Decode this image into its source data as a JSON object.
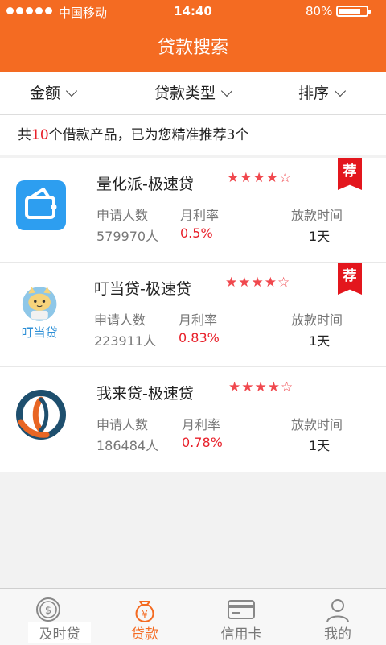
{
  "status_bar": {
    "carrier": "中国移动",
    "time": "14:40",
    "battery_percent": "80%",
    "battery_level": 0.8
  },
  "header": {
    "title": "贷款搜索"
  },
  "filters": [
    {
      "label": "金额"
    },
    {
      "label": "贷款类型"
    },
    {
      "label": "排序"
    }
  ],
  "summary": {
    "prefix": "共",
    "count": "10",
    "suffix": "个借款产品，已为您精准推荐3个"
  },
  "accent_color": "#f46b22",
  "highlight_color": "#e8212b",
  "products": [
    {
      "name": "量化派-极速贷",
      "stars": "★★★★☆",
      "rating": 4,
      "recommended": true,
      "badge": "荐",
      "applicants_label": "申请人数",
      "applicants": "579970人",
      "rate_label": "月利率",
      "rate": "0.5%",
      "time_label": "放款时间",
      "time": "1天",
      "logo": "wallet-icon"
    },
    {
      "name": "叮当贷-极速贷",
      "stars": "★★★★☆",
      "rating": 4,
      "recommended": true,
      "badge": "荐",
      "applicants_label": "申请人数",
      "applicants": "223911人",
      "rate_label": "月利率",
      "rate": "0.83%",
      "time_label": "放款时间",
      "time": "1天",
      "logo": "dingdangdai-logo",
      "logo_text": "叮当贷"
    },
    {
      "name": "我来贷-极速贷",
      "stars": "★★★★☆",
      "rating": 4,
      "recommended": false,
      "applicants_label": "申请人数",
      "applicants": "186484人",
      "rate_label": "月利率",
      "rate": "0.78%",
      "time_label": "放款时间",
      "time": "1天",
      "logo": "wolaidai-logo"
    }
  ],
  "tabbar": [
    {
      "label": "及时贷",
      "icon": "coin-icon",
      "active": false
    },
    {
      "label": "贷款",
      "icon": "money-bag-icon",
      "active": true
    },
    {
      "label": "信用卡",
      "icon": "credit-card-icon",
      "active": false
    },
    {
      "label": "我的",
      "icon": "person-icon",
      "active": false
    }
  ]
}
